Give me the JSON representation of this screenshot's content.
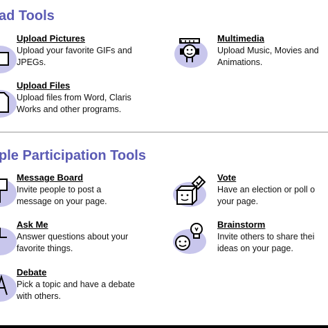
{
  "upload_section": {
    "title": "ad Tools",
    "tools": [
      {
        "name": "Upload Pictures",
        "desc_line1": "Upload your favorite GIFs and",
        "desc_line2": "JPEGs."
      },
      {
        "name": "Multimedia",
        "desc_line1": "Upload Music, Movies and",
        "desc_line2": "Animations."
      },
      {
        "name": "Upload Files",
        "desc_line1": "Upload files from Word, Claris",
        "desc_line2": "Works and other programs."
      }
    ]
  },
  "participation_section": {
    "title": "ple Participation Tools",
    "tools": [
      {
        "name": "Message Board",
        "desc_line1": "Invite people to post a",
        "desc_line2": "message on your page."
      },
      {
        "name": "Vote",
        "desc_line1": "Have an election or poll o",
        "desc_line2": "your page."
      },
      {
        "name": "Ask Me",
        "desc_line1": "Answer questions about your",
        "desc_line2": "favorite things."
      },
      {
        "name": "Brainstorm",
        "desc_line1": "Invite others to share thei",
        "desc_line2": "ideas on your page."
      },
      {
        "name": "Debate",
        "desc_line1": "Pick a topic and have a debate",
        "desc_line2": "with others."
      }
    ]
  },
  "colors": {
    "accent": "#5a5ab4",
    "blob": "#c8c6ec",
    "rule": "#c8c8c8"
  },
  "icons": [
    "picture-icon",
    "multimedia-icon",
    "file-icon",
    "message-board-icon",
    "vote-icon",
    "ask-me-icon",
    "brainstorm-icon",
    "debate-icon"
  ]
}
